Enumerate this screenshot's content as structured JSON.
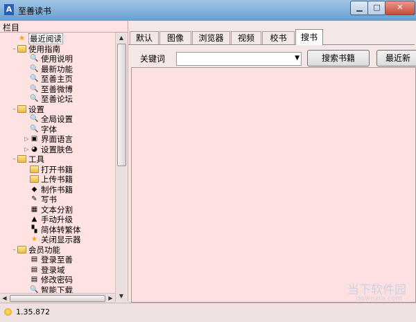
{
  "window": {
    "title": "至善读书",
    "app_icon_glyph": "A"
  },
  "sidebar": {
    "title": "栏目"
  },
  "tree": [
    {
      "label": "最近阅读",
      "level": 0,
      "icon": "star",
      "exp": "",
      "selected": true
    },
    {
      "label": "使用指南",
      "level": 0,
      "icon": "folder",
      "exp": "–"
    },
    {
      "label": "使用说明",
      "level": 1,
      "icon": "magnifier",
      "exp": ""
    },
    {
      "label": "最新功能",
      "level": 1,
      "icon": "magnifier",
      "exp": ""
    },
    {
      "label": "至善主页",
      "level": 1,
      "icon": "magnifier",
      "exp": ""
    },
    {
      "label": "至善微博",
      "level": 1,
      "icon": "magnifier",
      "exp": ""
    },
    {
      "label": "至善论坛",
      "level": 1,
      "icon": "magnifier",
      "exp": ""
    },
    {
      "label": "设置",
      "level": 0,
      "icon": "folder",
      "exp": "–"
    },
    {
      "label": "全局设置",
      "level": 1,
      "icon": "magnifier",
      "exp": ""
    },
    {
      "label": "字体",
      "level": 1,
      "icon": "magnifier",
      "exp": ""
    },
    {
      "label": "界面语言",
      "level": 1,
      "icon": "language",
      "exp": "▷"
    },
    {
      "label": "设置肤色",
      "level": 1,
      "icon": "color",
      "exp": "▷"
    },
    {
      "label": "工具",
      "level": 0,
      "icon": "folder",
      "exp": "–"
    },
    {
      "label": "打开书籍",
      "level": 1,
      "icon": "folder-open",
      "exp": ""
    },
    {
      "label": "上传书籍",
      "level": 1,
      "icon": "folder-open",
      "exp": ""
    },
    {
      "label": "制作书籍",
      "level": 1,
      "icon": "book",
      "exp": ""
    },
    {
      "label": "写书",
      "level": 1,
      "icon": "pen",
      "exp": ""
    },
    {
      "label": "文本分割",
      "level": 1,
      "icon": "split",
      "exp": ""
    },
    {
      "label": "手动升级",
      "level": 1,
      "icon": "upgrade",
      "exp": ""
    },
    {
      "label": "简体转繁体",
      "level": 1,
      "icon": "convert",
      "exp": ""
    },
    {
      "label": "关闭显示器",
      "level": 1,
      "icon": "star",
      "exp": ""
    },
    {
      "label": "会员功能",
      "level": 0,
      "icon": "folder",
      "exp": "–"
    },
    {
      "label": "登录至善",
      "level": 1,
      "icon": "network",
      "exp": ""
    },
    {
      "label": "登录域",
      "level": 1,
      "icon": "network",
      "exp": ""
    },
    {
      "label": "修改密码",
      "level": 1,
      "icon": "network",
      "exp": ""
    },
    {
      "label": "智能下载",
      "level": 1,
      "icon": "magnifier",
      "exp": ""
    }
  ],
  "tabs": [
    {
      "label": "默认",
      "active": false
    },
    {
      "label": "图像",
      "active": false
    },
    {
      "label": "浏览器",
      "active": false
    },
    {
      "label": "视频",
      "active": false
    },
    {
      "label": "校书",
      "active": false
    },
    {
      "label": "搜书",
      "active": true
    }
  ],
  "search": {
    "keyword_label": "关键词",
    "keyword_value": "",
    "search_button": "搜索书籍",
    "recent_button": "最近新"
  },
  "status": {
    "version": "1.35.872"
  },
  "watermark": {
    "text": "当下软件园",
    "sub": "downxia.com"
  }
}
